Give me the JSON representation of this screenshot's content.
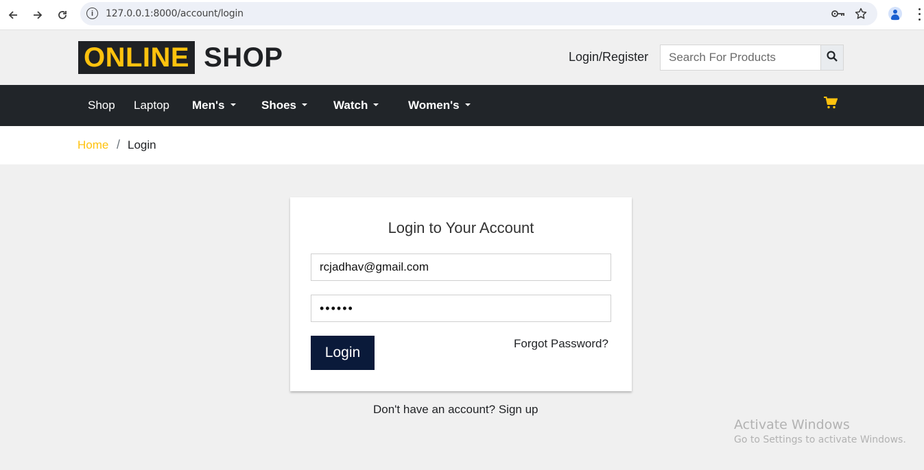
{
  "browser": {
    "url": "127.0.0.1:8000/account/login",
    "back_icon": "arrow-left-icon",
    "forward_icon": "arrow-right-icon",
    "reload_icon": "reload-icon",
    "key_icon": "key-icon",
    "star_icon": "star-icon",
    "profile_icon": "profile-icon",
    "menu_icon": "kebab-menu-icon"
  },
  "header": {
    "logo_highlight": "ONLINE",
    "logo_text": "SHOP",
    "login_register": "Login/Register",
    "search_placeholder": "Search For Products",
    "search_icon": "search-icon",
    "brand_accent": "#ffc20e",
    "dark_color": "#212529"
  },
  "navbar": {
    "items": [
      {
        "label": "Shop",
        "dropdown": false
      },
      {
        "label": "Laptop",
        "dropdown": false
      },
      {
        "label": "Men's",
        "dropdown": true
      },
      {
        "label": "Shoes",
        "dropdown": true
      },
      {
        "label": "Watch",
        "dropdown": true
      },
      {
        "label": "Women's",
        "dropdown": true
      }
    ],
    "cart_icon": "shopping-cart-icon"
  },
  "breadcrumb": {
    "home": "Home",
    "separator": "/",
    "current": "Login"
  },
  "login_form": {
    "title": "Login to Your Account",
    "email_value": "rcjadhav@gmail.com",
    "password_value": "••••••",
    "login_button": "Login",
    "forgot_password": "Forgot Password?",
    "button_color": "#0a1a3a"
  },
  "signup": {
    "prompt": "Don't have an account?",
    "link": "Sign up"
  },
  "watermark": {
    "title": "Activate Windows",
    "subtitle": "Go to Settings to activate Windows."
  }
}
